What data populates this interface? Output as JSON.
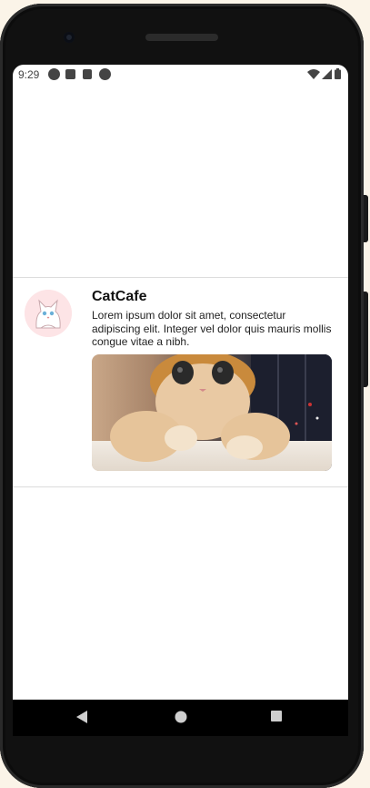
{
  "status_bar": {
    "time": "9:29",
    "left_icons": [
      "notification-icon",
      "a-icon",
      "sd-card-icon",
      "sync-icon"
    ],
    "right_icons": [
      "wifi-icon",
      "signal-icon",
      "battery-icon"
    ]
  },
  "post": {
    "author": "CatCafe",
    "text": "Lorem ipsum dolor sit amet, consectetur adipiscing elit. Integer vel dolor quis mauris mollis congue vitae a nibh.",
    "avatar_icon": "cat-avatar-icon",
    "image_icon": "cat-photo"
  },
  "nav_bar": {
    "buttons": [
      "back-icon",
      "home-icon",
      "recents-icon"
    ]
  },
  "colors": {
    "background": "#fbf4e8",
    "phone": "#111111",
    "screen": "#ffffff",
    "avatar_bg": "#fde4e6",
    "divider": "#dcdcdc"
  }
}
